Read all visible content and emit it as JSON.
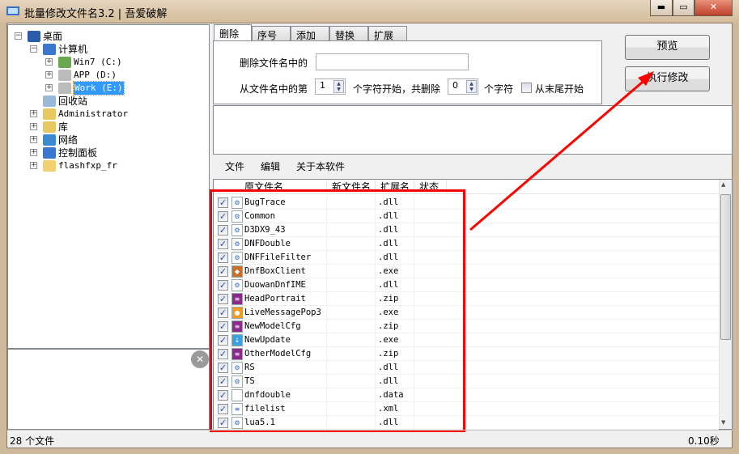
{
  "window": {
    "title": "批量修改文件名3.2 | 吾爱破解",
    "minimize": "▬",
    "maximize": "▭",
    "close": "✕"
  },
  "tree": [
    {
      "label": "桌面",
      "icon": "desktop-icon",
      "expander": "−"
    },
    {
      "label": "计算机",
      "icon": "computer-icon",
      "expander": "−"
    },
    {
      "label": "Win7 (C:)",
      "icon": "windows-drive-icon",
      "expander": "+"
    },
    {
      "label": "APP (D:)",
      "icon": "drive-icon",
      "expander": "+"
    },
    {
      "label": "Work (E:)",
      "icon": "drive-icon",
      "expander": "+",
      "selected": true
    },
    {
      "label": "回收站",
      "icon": "recycle-bin-icon",
      "expander": ""
    },
    {
      "label": "Administrator",
      "icon": "user-folder-icon",
      "expander": "+"
    },
    {
      "label": "库",
      "icon": "library-icon",
      "expander": "+"
    },
    {
      "label": "网络",
      "icon": "network-icon",
      "expander": "+"
    },
    {
      "label": "控制面板",
      "icon": "control-panel-icon",
      "expander": "+"
    },
    {
      "label": "flashfxp_fr",
      "icon": "folder-icon",
      "expander": "+"
    }
  ],
  "tabs": [
    "删除",
    "序号",
    "添加",
    "替换",
    "扩展名"
  ],
  "delete_tab": {
    "label_delete_in_name": "删除文件名中的",
    "delete_text_value": "",
    "label_from_pos": "从文件名中的第",
    "start_value": "1",
    "label_chars_start": "个字符开始，共删除",
    "count_value": "0",
    "label_chars": "个字符",
    "from_end_label": "从末尾开始",
    "from_end_checked": false
  },
  "buttons": {
    "preview": "预览",
    "execute": "执行修改"
  },
  "menu": [
    "文件",
    "编辑",
    "关于本软件"
  ],
  "columns": [
    "原文件名",
    "新文件名",
    "扩展名",
    "状态"
  ],
  "files": [
    {
      "name": "BugTrace",
      "new": "",
      "ext": ".dll",
      "icon": "dll-icon"
    },
    {
      "name": "Common",
      "new": "",
      "ext": ".dll",
      "icon": "dll-icon"
    },
    {
      "name": "D3DX9_43",
      "new": "",
      "ext": ".dll",
      "icon": "dll-icon"
    },
    {
      "name": "DNFDouble",
      "new": "",
      "ext": ".dll",
      "icon": "dll-icon"
    },
    {
      "name": "DNFFileFilter",
      "new": "",
      "ext": ".dll",
      "icon": "dll-icon"
    },
    {
      "name": "DnfBoxClient",
      "new": "",
      "ext": ".exe",
      "icon": "game-exe-icon"
    },
    {
      "name": "DuowanDnfIME",
      "new": "",
      "ext": ".dll",
      "icon": "dll-icon"
    },
    {
      "name": "HeadPortrait",
      "new": "",
      "ext": ".zip",
      "icon": "winrar-icon"
    },
    {
      "name": "LiveMessagePop3",
      "new": "",
      "ext": ".exe",
      "icon": "orange-exe-icon"
    },
    {
      "name": "NewModelCfg",
      "new": "",
      "ext": ".zip",
      "icon": "winrar-icon"
    },
    {
      "name": "NewUpdate",
      "new": "",
      "ext": ".exe",
      "icon": "update-exe-icon"
    },
    {
      "name": "OtherModelCfg",
      "new": "",
      "ext": ".zip",
      "icon": "winrar-icon"
    },
    {
      "name": "RS",
      "new": "",
      "ext": ".dll",
      "icon": "dll-icon"
    },
    {
      "name": "TS",
      "new": "",
      "ext": ".dll",
      "icon": "dll-icon"
    },
    {
      "name": "dnfdouble",
      "new": "",
      "ext": ".data",
      "icon": "blank-file-icon"
    },
    {
      "name": "filelist",
      "new": "",
      "ext": ".xml",
      "icon": "xml-icon"
    },
    {
      "name": "lua5.1",
      "new": "",
      "ext": ".dll",
      "icon": "dll-icon"
    }
  ],
  "status": {
    "count": "28 个文件",
    "time": "0.10秒"
  },
  "colors": {
    "annotation": "#ff0000",
    "selection": "#3399ff"
  }
}
